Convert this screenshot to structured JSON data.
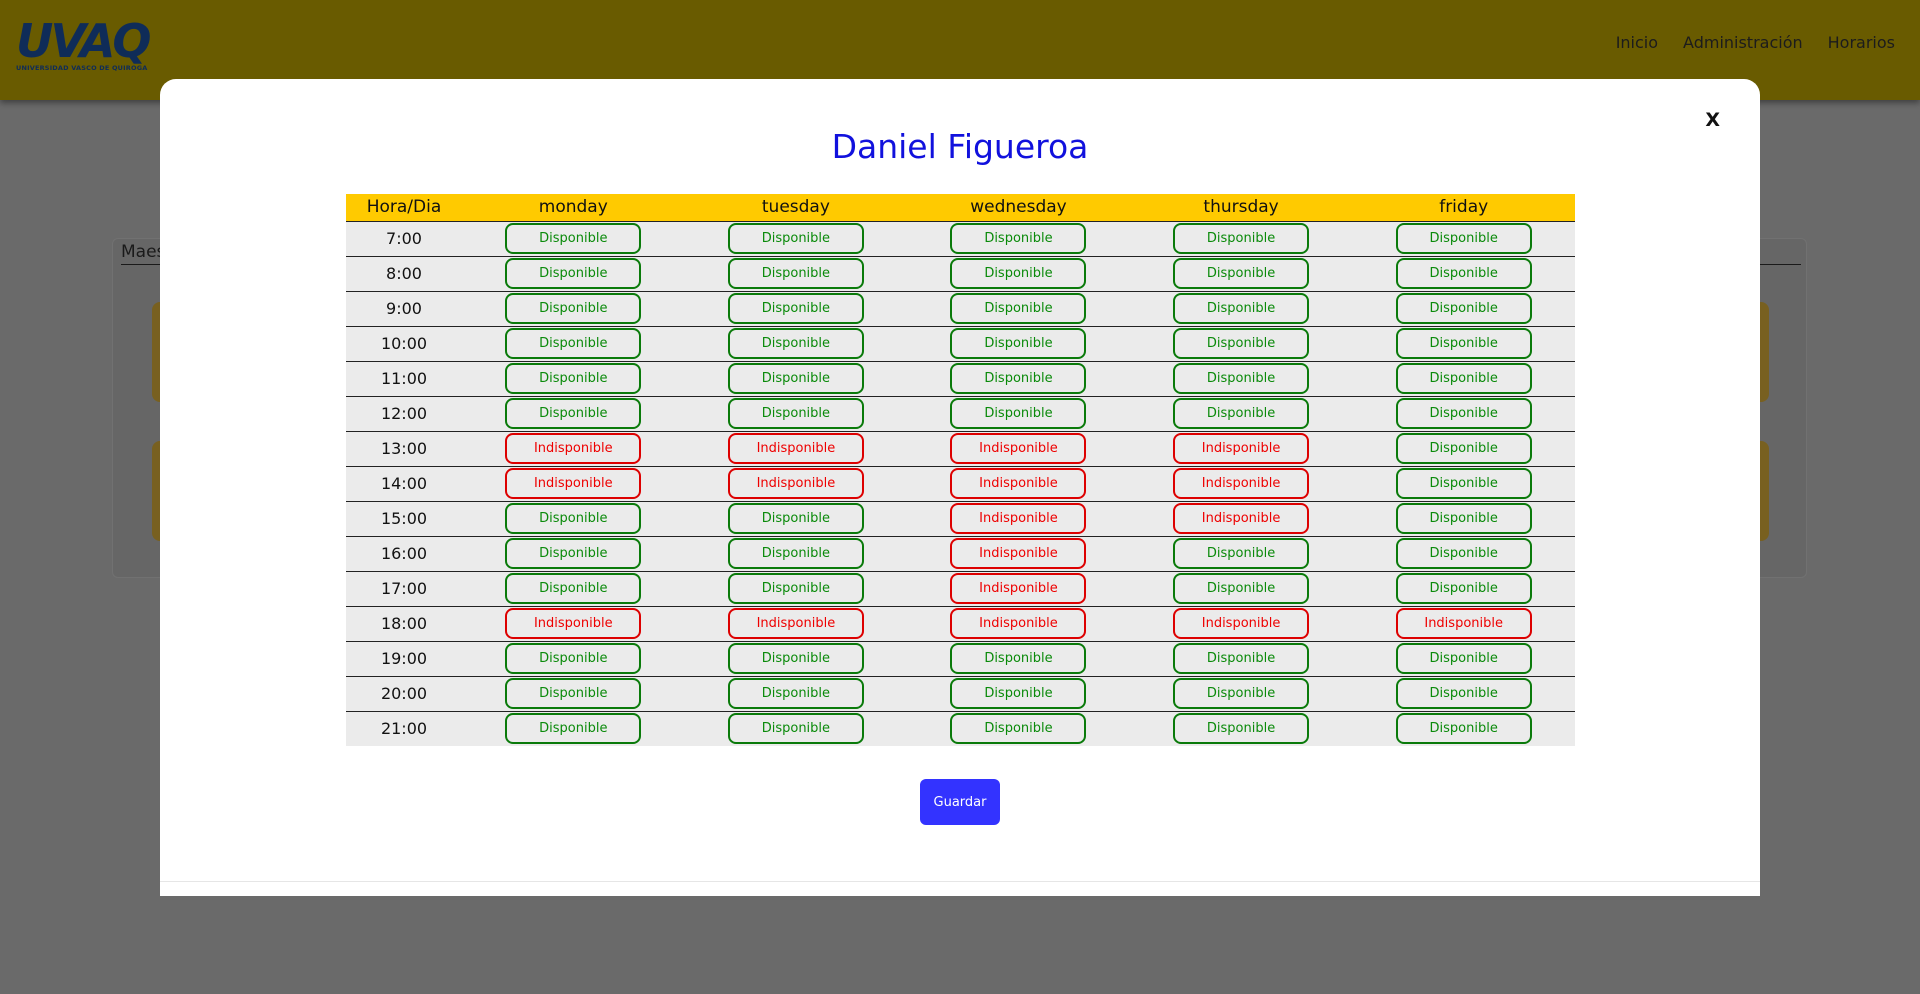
{
  "header": {
    "logo_text": "UVAQ",
    "logo_subtitle": "UNIVERSIDAD VASCO DE QUIROGA",
    "nav": [
      {
        "label": "Inicio"
      },
      {
        "label": "Administración"
      },
      {
        "label": "Horarios"
      }
    ]
  },
  "background": {
    "section_label": "Maes"
  },
  "modal": {
    "close_label": "X",
    "title": "Daniel Figueroa",
    "save_label": "Guardar",
    "columns": [
      "Hora/Dia",
      "monday",
      "tuesday",
      "wednesday",
      "thursday",
      "friday"
    ],
    "rows": [
      {
        "hour": "7:00",
        "slots": [
          "Disponible",
          "Disponible",
          "Disponible",
          "Disponible",
          "Disponible"
        ]
      },
      {
        "hour": "8:00",
        "slots": [
          "Disponible",
          "Disponible",
          "Disponible",
          "Disponible",
          "Disponible"
        ]
      },
      {
        "hour": "9:00",
        "slots": [
          "Disponible",
          "Disponible",
          "Disponible",
          "Disponible",
          "Disponible"
        ]
      },
      {
        "hour": "10:00",
        "slots": [
          "Disponible",
          "Disponible",
          "Disponible",
          "Disponible",
          "Disponible"
        ]
      },
      {
        "hour": "11:00",
        "slots": [
          "Disponible",
          "Disponible",
          "Disponible",
          "Disponible",
          "Disponible"
        ]
      },
      {
        "hour": "12:00",
        "slots": [
          "Disponible",
          "Disponible",
          "Disponible",
          "Disponible",
          "Disponible"
        ]
      },
      {
        "hour": "13:00",
        "slots": [
          "Indisponible",
          "Indisponible",
          "Indisponible",
          "Indisponible",
          "Disponible"
        ]
      },
      {
        "hour": "14:00",
        "slots": [
          "Indisponible",
          "Indisponible",
          "Indisponible",
          "Indisponible",
          "Disponible"
        ]
      },
      {
        "hour": "15:00",
        "slots": [
          "Disponible",
          "Disponible",
          "Indisponible",
          "Indisponible",
          "Disponible"
        ]
      },
      {
        "hour": "16:00",
        "slots": [
          "Disponible",
          "Disponible",
          "Indisponible",
          "Disponible",
          "Disponible"
        ]
      },
      {
        "hour": "17:00",
        "slots": [
          "Disponible",
          "Disponible",
          "Indisponible",
          "Disponible",
          "Disponible"
        ]
      },
      {
        "hour": "18:00",
        "slots": [
          "Indisponible",
          "Indisponible",
          "Indisponible",
          "Indisponible",
          "Indisponible"
        ]
      },
      {
        "hour": "19:00",
        "slots": [
          "Disponible",
          "Disponible",
          "Disponible",
          "Disponible",
          "Disponible"
        ]
      },
      {
        "hour": "20:00",
        "slots": [
          "Disponible",
          "Disponible",
          "Disponible",
          "Disponible",
          "Disponible"
        ]
      },
      {
        "hour": "21:00",
        "slots": [
          "Disponible",
          "Disponible",
          "Disponible",
          "Disponible",
          "Disponible"
        ]
      }
    ]
  },
  "colors": {
    "header_bg": "#695b00",
    "table_header_bg": "#ffca00",
    "available": "#0a8a0a",
    "unavailable": "#ee0000",
    "title": "#1111dd",
    "save_button": "#3333ff"
  }
}
